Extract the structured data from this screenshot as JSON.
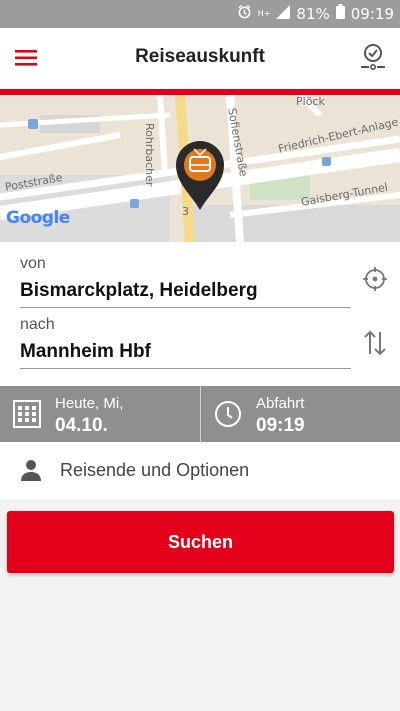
{
  "status_bar": {
    "network": "H+",
    "battery": "81%",
    "time": "09:19"
  },
  "header": {
    "title": "Reiseauskunft",
    "menu_icon": "hamburger-menu-icon",
    "right_icon": "clock-alarm-icon"
  },
  "map": {
    "street_labels": [
      "Plöck",
      "Rohrbacher",
      "Sofienstraße",
      "Friedrich-Ebert-Anlage",
      "Poststraße",
      "Gaisberg-Tunnel",
      "3"
    ],
    "logo": "Google",
    "pin_icon": "tram-stop-pin-icon"
  },
  "form": {
    "from_label": "von",
    "from_value": "Bismarckplatz, Heidelberg",
    "to_label": "nach",
    "to_value": "Mannheim Hbf",
    "locate_icon": "location-target-icon",
    "swap_icon": "swap-arrows-icon"
  },
  "datetime": {
    "date_label": "Heute, Mi,",
    "date_value": "04.10.",
    "time_label": "Abfahrt",
    "time_value": "09:19"
  },
  "options": {
    "label": "Reisende und Optionen"
  },
  "search": {
    "label": "Suchen"
  },
  "colors": {
    "brand_red": "#e2001a",
    "bar_grey": "#8f8f8f",
    "status_grey": "#9c9c9c"
  }
}
